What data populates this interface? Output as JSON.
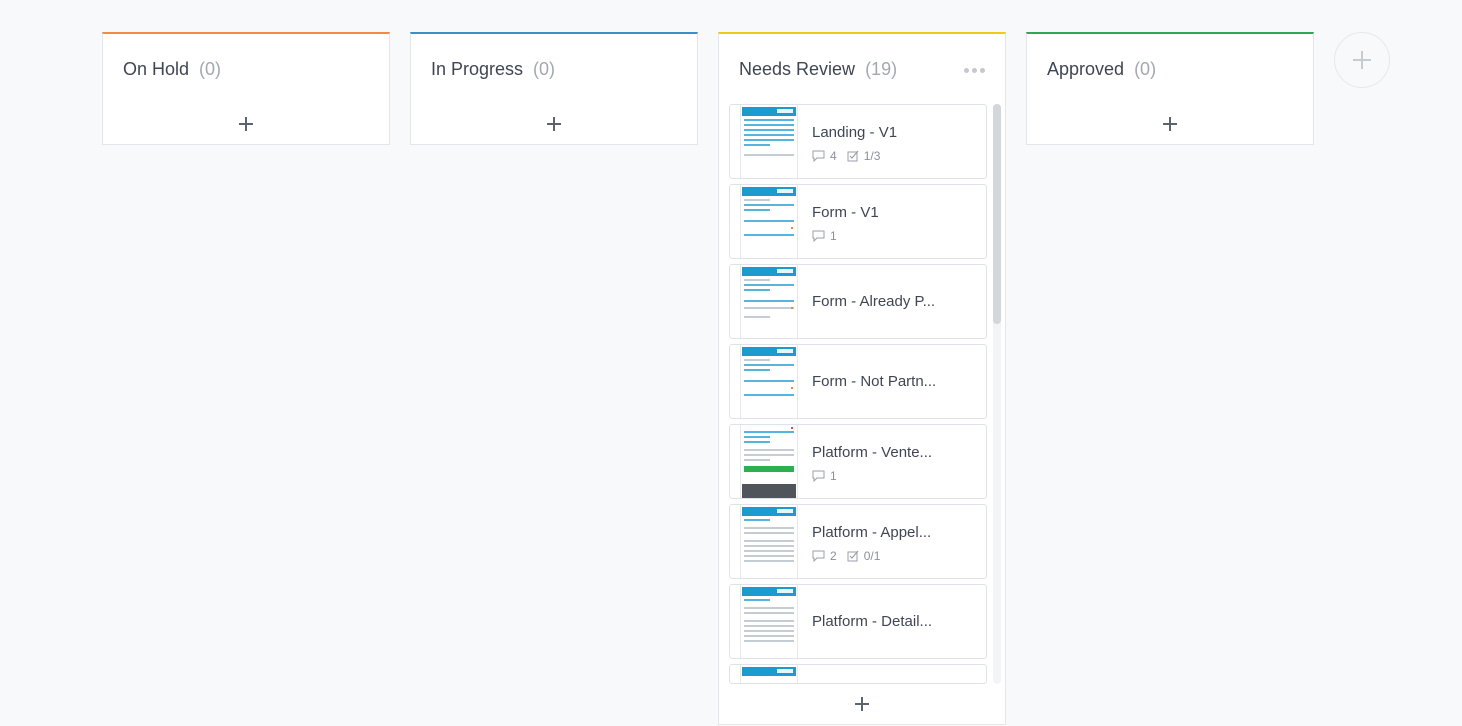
{
  "columns": [
    {
      "title": "On Hold",
      "count": "(0)",
      "color": "#f08a45"
    },
    {
      "title": "In Progress",
      "count": "(0)",
      "color": "#3a8fc8"
    },
    {
      "title": "Needs Review",
      "count": "(19)",
      "color": "#f2c81b"
    },
    {
      "title": "Approved",
      "count": "(0)",
      "color": "#2fa55a"
    }
  ],
  "cards": [
    {
      "title": "Landing - V1",
      "comments": "4",
      "tasks": "1/3"
    },
    {
      "title": "Form - V1",
      "comments": "1"
    },
    {
      "title": "Form - Already P..."
    },
    {
      "title": "Form - Not Partn..."
    },
    {
      "title": "Platform - Vente...",
      "comments": "1"
    },
    {
      "title": "Platform - Appel...",
      "comments": "2",
      "tasks": "0/1"
    },
    {
      "title": "Platform - Detail..."
    }
  ],
  "icons": {
    "add": "plus-icon",
    "menu": "more-horizontal-icon",
    "comment": "comment-icon",
    "task": "checkbox-icon"
  }
}
